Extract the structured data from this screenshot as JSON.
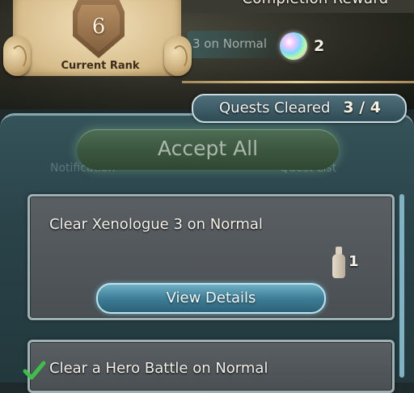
{
  "header": {
    "completion_title": "Completion Reward",
    "mission_peek": "3 on Normal",
    "reward": {
      "icon": "orb-icon",
      "count": "2"
    }
  },
  "rank": {
    "number": "6",
    "label": "Current Rank"
  },
  "quests": {
    "label": "Quests Cleared",
    "count": "3 / 4"
  },
  "panel": {
    "accept_all_label": "Accept All",
    "ghost_left": "Notification",
    "ghost_right": "Quest List"
  },
  "quest_cards": [
    {
      "title": "Clear Xenologue 3 on Normal",
      "reward_icon": "dueling-crest-icon",
      "reward_qty": "1",
      "details_label": "View Details"
    },
    {
      "title": "Clear a Hero Battle on Normal",
      "status_icon": "checkmark-icon"
    }
  ],
  "colors": {
    "accent_blue": "#6fb0c6",
    "check_green": "#3fbf4a",
    "scroll_parchment": "#d7bd8b"
  }
}
